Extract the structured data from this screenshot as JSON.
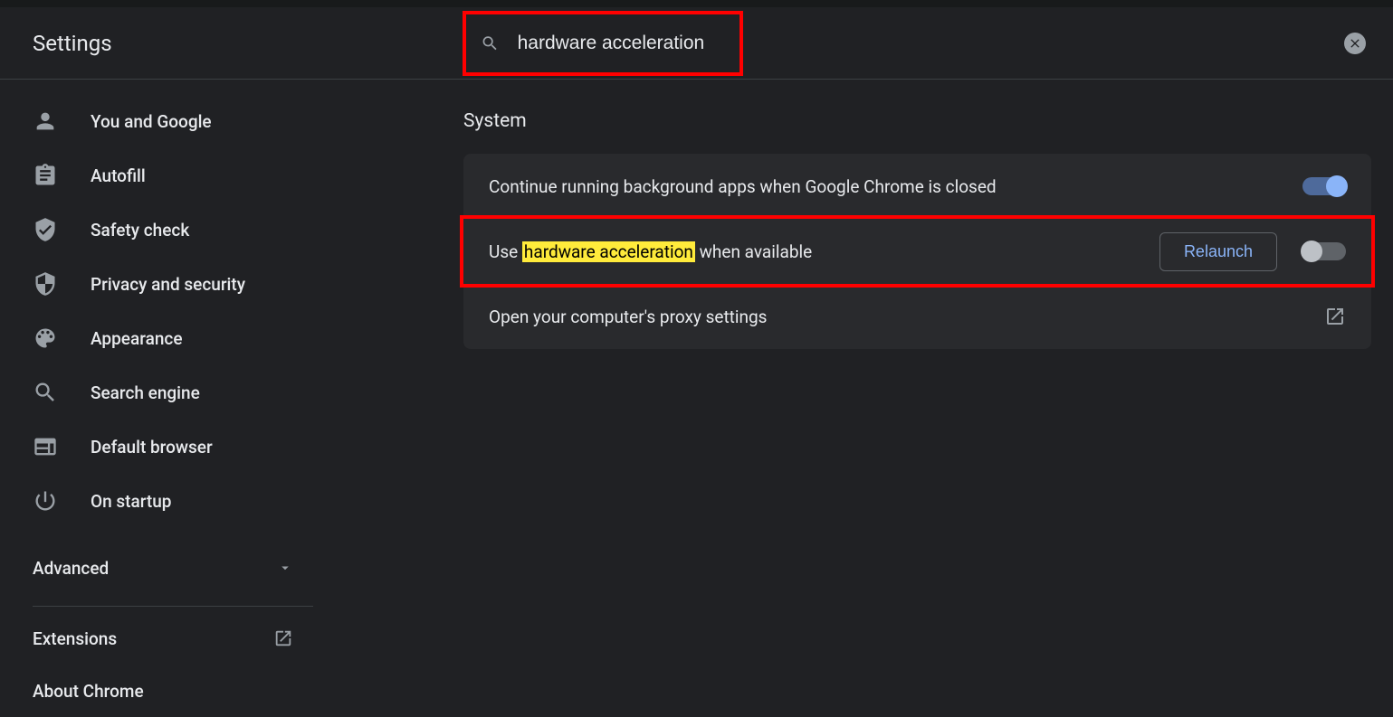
{
  "header": {
    "title": "Settings",
    "search_value": "hardware acceleration"
  },
  "sidebar": {
    "items": [
      {
        "label": "You and Google",
        "icon": "person-icon"
      },
      {
        "label": "Autofill",
        "icon": "autofill-icon"
      },
      {
        "label": "Safety check",
        "icon": "safety-check-icon"
      },
      {
        "label": "Privacy and security",
        "icon": "security-icon"
      },
      {
        "label": "Appearance",
        "icon": "appearance-icon"
      },
      {
        "label": "Search engine",
        "icon": "search-engine-icon"
      },
      {
        "label": "Default browser",
        "icon": "default-browser-icon"
      },
      {
        "label": "On startup",
        "icon": "startup-icon"
      }
    ],
    "advanced_label": "Advanced",
    "extensions_label": "Extensions",
    "about_label": "About Chrome"
  },
  "main": {
    "section_title": "System",
    "row1_label": "Continue running background apps when Google Chrome is closed",
    "row1_toggle": true,
    "row2_pre": "Use ",
    "row2_highlight": "hardware acceleration",
    "row2_post": " when available",
    "row2_toggle": false,
    "relaunch_label": "Relaunch",
    "row3_label": "Open your computer's proxy settings"
  }
}
